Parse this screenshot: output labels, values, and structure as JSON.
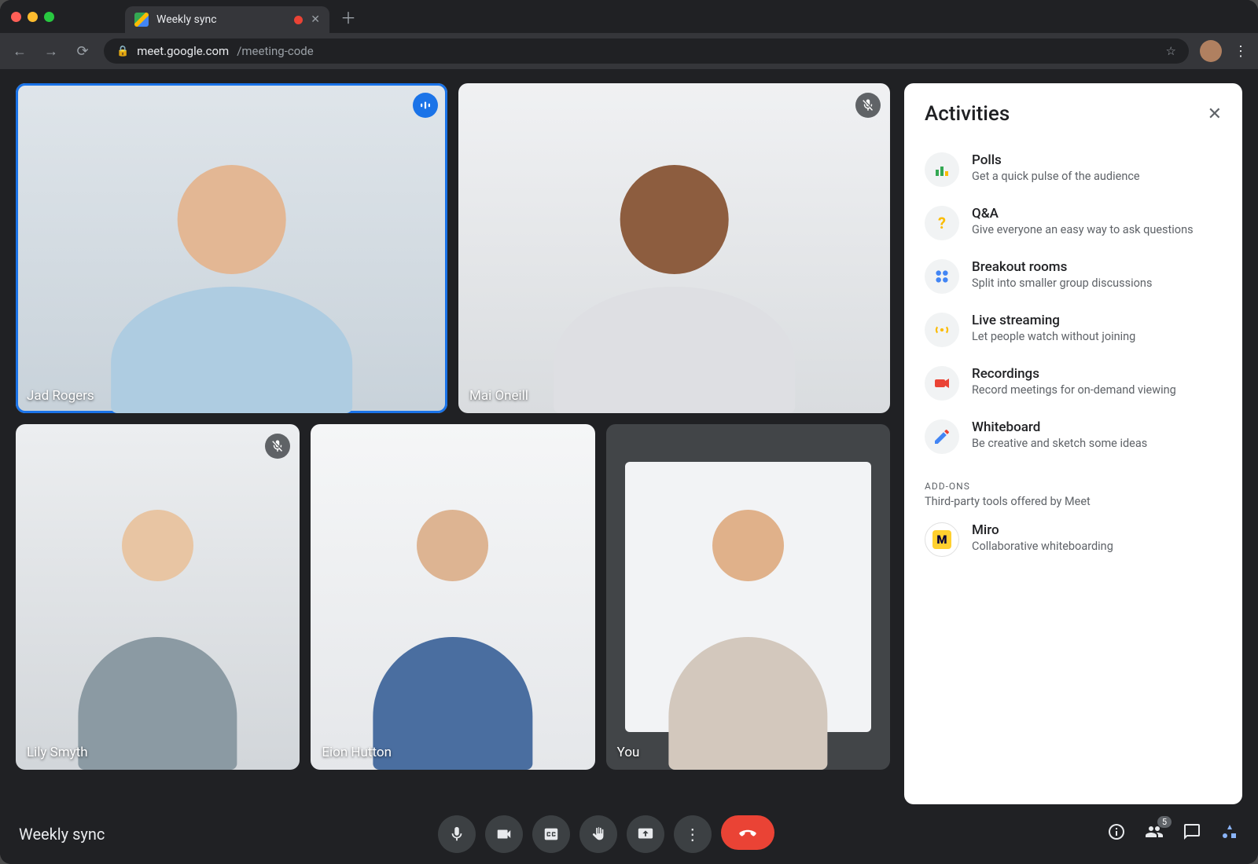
{
  "browser": {
    "tab_title": "Weekly sync",
    "url_host": "meet.google.com",
    "url_path": "/meeting-code"
  },
  "participants": [
    {
      "name": "Jad Rogers",
      "status": "speaking",
      "active": true
    },
    {
      "name": "Mai Oneill",
      "status": "muted",
      "active": false
    },
    {
      "name": "Lily Smyth",
      "status": "muted",
      "active": false
    },
    {
      "name": "Eion Hutton",
      "status": "none",
      "active": false
    },
    {
      "name": "You",
      "status": "none",
      "active": false
    }
  ],
  "panel": {
    "title": "Activities",
    "activities": [
      {
        "title": "Polls",
        "desc": "Get a quick pulse of the audience",
        "icon": "polls"
      },
      {
        "title": "Q&A",
        "desc": "Give everyone an easy way to ask questions",
        "icon": "qa"
      },
      {
        "title": "Breakout rooms",
        "desc": "Split into smaller group discussions",
        "icon": "breakout"
      },
      {
        "title": "Live streaming",
        "desc": "Let people watch without joining",
        "icon": "stream"
      },
      {
        "title": "Recordings",
        "desc": "Record meetings for on-demand viewing",
        "icon": "record"
      },
      {
        "title": "Whiteboard",
        "desc": "Be creative and sketch some ideas",
        "icon": "whiteboard"
      }
    ],
    "addons_label": "ADD-ONS",
    "addons_sub": "Third-party tools offered by Meet",
    "addons": [
      {
        "title": "Miro",
        "desc": "Collaborative whiteboarding"
      }
    ]
  },
  "bottom": {
    "meeting_name": "Weekly sync",
    "participant_count": "5"
  }
}
